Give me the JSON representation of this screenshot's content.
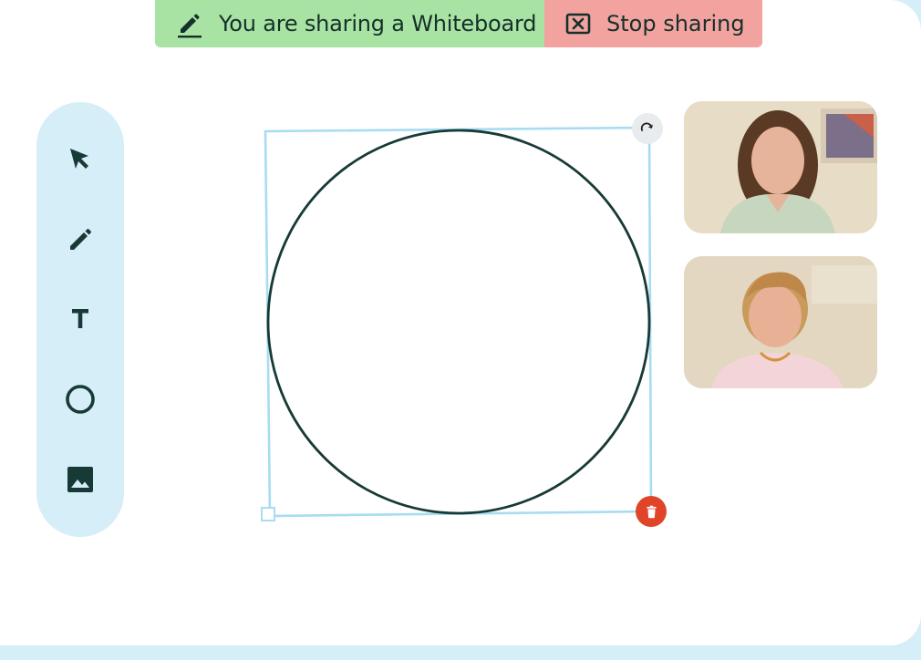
{
  "share_banner": {
    "status_label": "You are sharing a Whiteboard",
    "status_icon": "pencil-icon",
    "stop_label": "Stop sharing",
    "stop_icon": "close-box-icon",
    "status_color": "#a9e3a3",
    "stop_color": "#f2a3a0"
  },
  "toolbar": {
    "tools": [
      {
        "name": "select",
        "icon": "cursor-icon"
      },
      {
        "name": "pen",
        "icon": "pencil-icon"
      },
      {
        "name": "text",
        "icon": "text-icon"
      },
      {
        "name": "shape",
        "icon": "circle-icon"
      },
      {
        "name": "image",
        "icon": "image-icon"
      }
    ]
  },
  "canvas": {
    "selected_shape": "circle",
    "handles": [
      "rotate-icon",
      "trash-icon",
      "resize-handle"
    ],
    "selection_color": "#a8dcf2",
    "delete_color": "#e0452a"
  },
  "participants": [
    {
      "tile": "participant-video-1"
    },
    {
      "tile": "participant-video-2"
    }
  ]
}
